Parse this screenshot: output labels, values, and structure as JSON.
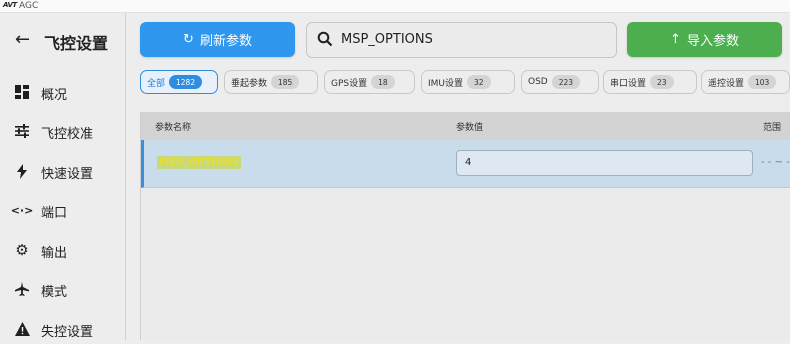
{
  "app": {
    "logo_text": "AVT",
    "title": "AGC"
  },
  "sidebar": {
    "back_icon": "arrow-left-icon",
    "title": "飞控设置",
    "items": [
      {
        "label": "概况",
        "icon": "dashboard-icon"
      },
      {
        "label": "飞控校准",
        "icon": "sliders-icon"
      },
      {
        "label": "快速设置",
        "icon": "lightning-icon"
      },
      {
        "label": "端口",
        "icon": "port-icon"
      },
      {
        "label": "输出",
        "icon": "gear-icon"
      },
      {
        "label": "模式",
        "icon": "airplane-icon"
      },
      {
        "label": "失控设置",
        "icon": "warning-icon"
      }
    ]
  },
  "toolbar": {
    "refresh_label": "刷新参数",
    "search_value": "MSP_OPTIONS",
    "import_label": "导入参数",
    "refresh_color": "#3097ee",
    "import_color": "#4cae4f"
  },
  "filters": [
    {
      "label": "全部",
      "count": "1282",
      "active": true
    },
    {
      "label": "垂起参数",
      "count": "185"
    },
    {
      "label": "GPS设置",
      "count": "18"
    },
    {
      "label": "IMU设置",
      "count": "32"
    },
    {
      "label": "OSD",
      "count": "223"
    },
    {
      "label": "串口设置",
      "count": "23"
    },
    {
      "label": "遥控设置",
      "count": "103"
    }
  ],
  "table": {
    "headers": {
      "name": "参数名称",
      "value": "参数值",
      "range": "范围"
    },
    "rows": [
      {
        "name": "MSP_OPTIONS",
        "value": "4",
        "range": "- - ~ -"
      }
    ]
  }
}
